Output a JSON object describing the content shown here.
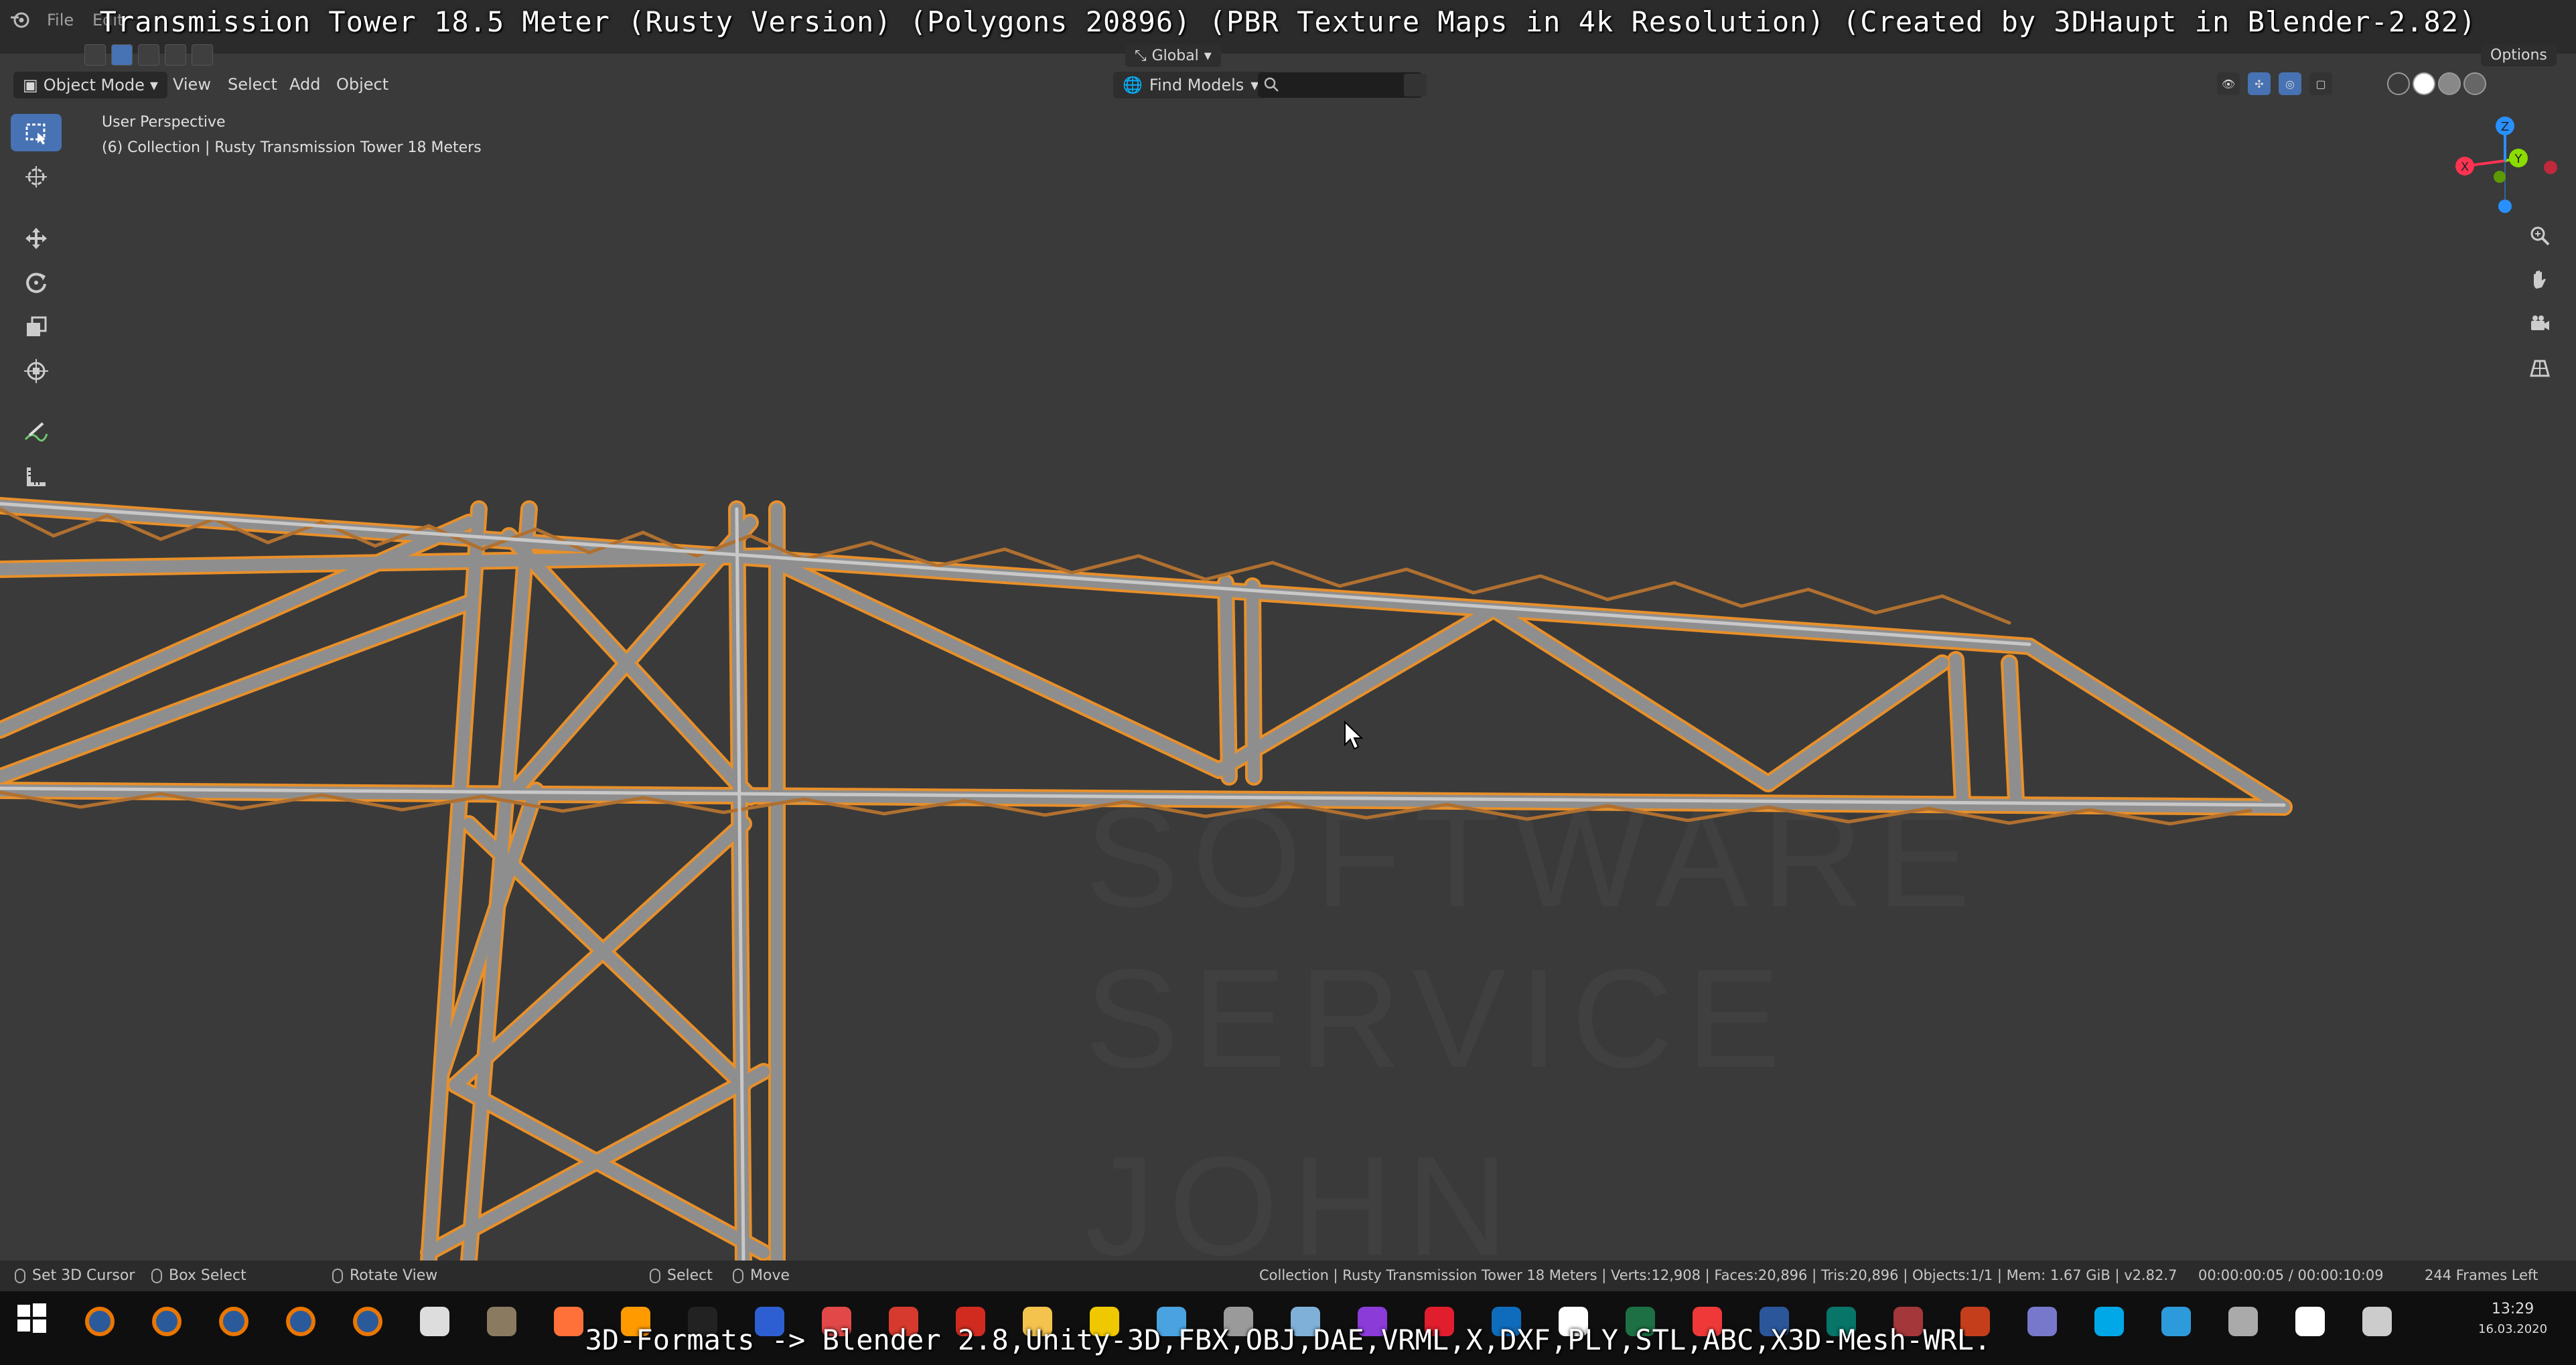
{
  "video": {
    "title": "Transmission Tower 18.5 Meter (Rusty Version) (Polygons 20896) (PBR Texture Maps in 4k Resolution) (Created by 3DHaupt in Blender-2.82)",
    "bottom_banner": "3D-Formats -> Blender 2.8,Unity-3D,FBX,OBJ,DAE,VRML,X,DXF,PLY,STL,ABC,X3D-Mesh-WRL."
  },
  "menubar": {
    "items": [
      "File",
      "Edit"
    ]
  },
  "header": {
    "mode": "Object Mode",
    "menus": [
      "View",
      "Select",
      "Add",
      "Object"
    ],
    "transform_orientation": "Global",
    "find_models": "Find Models",
    "options": "Options"
  },
  "viewport": {
    "perspective_label": "User Perspective",
    "collection_label": "(6) Collection | Rusty Transmission Tower 18 Meters",
    "watermark": [
      "SOFTWARE",
      "SERVICE",
      "JOHN"
    ],
    "gizmo": {
      "x": "X",
      "y": "Y",
      "z": "Z",
      "x_color": "#ff3352",
      "y_color": "#8bdc00",
      "z_color": "#2890ff"
    }
  },
  "toolbar": {
    "tools": [
      "select-box",
      "cursor",
      "move",
      "rotate",
      "scale",
      "transform",
      "annotate",
      "measure"
    ]
  },
  "statusbar": {
    "set_cursor": "Set 3D Cursor",
    "box_select": "Box Select",
    "rotate_view": "Rotate View",
    "select": "Select",
    "move": "Move",
    "stats": "Collection | Rusty Transmission Tower 18 Meters | Verts:12,908 | Faces:20,896 | Tris:20,896 | Objects:1/1 | Mem: 1.67 GiB | v2.82.7",
    "time": "00:00:00:05 / 00:00:10:09",
    "frames_left": "244 Frames Left"
  },
  "taskbar": {
    "time": "13:29",
    "date": "16.03.2020",
    "icons": [
      "blender-icon",
      "blender-icon",
      "blender-icon",
      "blender-icon",
      "blender-icon",
      "unity-icon",
      "gimp-icon",
      "firefox-icon",
      "flame-icon",
      "terminal-icon",
      "save-icon",
      "network-icon",
      "puzzle-icon",
      "acrobat-icon",
      "folder-icon",
      "xampp-icon",
      "paint-icon",
      "tool-icon",
      "book-icon",
      "gem-icon",
      "opera-icon",
      "outlook-icon",
      "edge-icon",
      "excel-icon",
      "vivaldi-icon",
      "word-icon",
      "publisher-icon",
      "access-icon",
      "powerpoint-icon",
      "settings-icon",
      "skype-icon",
      "feather-icon",
      "hammer-icon",
      "unity-hub-icon",
      "obs-icon"
    ],
    "icon_colors": [
      "#ea7600",
      "#ea7600",
      "#ea7600",
      "#ea7600",
      "#ea7600",
      "#dddddd",
      "#8a7a60",
      "#ff7139",
      "#ff9a00",
      "#222222",
      "#2d5fd3",
      "#e24848",
      "#d63a2e",
      "#d12b1f",
      "#f4c34d",
      "#f0c800",
      "#4aa3e0",
      "#9a9a9a",
      "#7fb0d8",
      "#8a3bd8",
      "#e01e2e",
      "#0f6cbd",
      "#ffffff",
      "#1d7044",
      "#ef3939",
      "#2b579a",
      "#077568",
      "#a4373a",
      "#c43e1c",
      "#7777cc",
      "#00a8e8",
      "#2d9bdb",
      "#aaaaaa",
      "#ffffff",
      "#cccccc"
    ]
  }
}
